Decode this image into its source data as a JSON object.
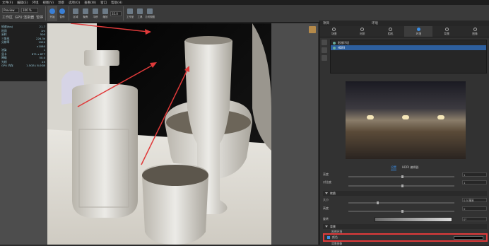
{
  "menu": [
    "文件(F)",
    "编辑(E)",
    "环境",
    "视图(V)",
    "场景",
    "选项(O)",
    "查看(W)",
    "窗口",
    "帮助(H)"
  ],
  "toolbar": {
    "render_mode": "Preview",
    "resolution": "100 %",
    "left_labels": [
      "工作区",
      "GPU 渲染器",
      "暂停"
    ],
    "buttons": [
      {
        "label": "开始"
      },
      {
        "label": "暂停"
      },
      {
        "label": "区域"
      },
      {
        "label": "聚焦"
      },
      {
        "label": "平移"
      },
      {
        "label": "缩放"
      }
    ],
    "fov_value": "35.0",
    "right_buttons": [
      {
        "label": "工作室"
      },
      {
        "label": "工具"
      },
      {
        "label": "几何视图"
      }
    ]
  },
  "stats": [
    [
      "帧速(fps)",
      "21.7"
    ],
    [
      "时间",
      "1m"
    ],
    [
      "采样",
      "500"
    ],
    [
      "三角形",
      "226.3k"
    ],
    [
      "分辨率",
      "1920"
    ],
    [
      "",
      "x1080"
    ],
    [
      "渲染",
      "1"
    ],
    [
      "显卡",
      "871 x 877"
    ],
    [
      "降噪",
      "50.0"
    ],
    [
      "光线",
      "25"
    ],
    [
      "GPU 内存",
      "1.5GB / 8.0GB"
    ]
  ],
  "panel": {
    "title": "项目",
    "header_right": "环境",
    "tabs": [
      {
        "label": "场景"
      },
      {
        "label": "材质"
      },
      {
        "label": "相机"
      },
      {
        "label": "环境"
      },
      {
        "label": "背景"
      },
      {
        "label": "图像"
      }
    ],
    "env_items": [
      {
        "label": "影棚环境"
      },
      {
        "label": "HDRI"
      }
    ],
    "subtabs": [
      "设置",
      "HDRI 编辑器"
    ],
    "rows": {
      "brightness": {
        "label": "亮度",
        "value": "1"
      },
      "contrast": {
        "label": "对比度",
        "value": "1"
      },
      "size": {
        "label": "大小",
        "value": "0.5 厘米"
      },
      "height": {
        "label": "高度",
        "value": "0"
      },
      "rotation": {
        "label": "旋转",
        "value": "0°"
      }
    },
    "sections": {
      "transform": "转换",
      "background": "背景",
      "ground": "地面"
    },
    "bg_option_label": "照明环境",
    "bg_color_label": "颜色",
    "bg_image_label": "背景图像",
    "ground_shadow_label": "地面阴影"
  },
  "colors": {
    "accent": "#3a8ee6",
    "highlight_box": "#e03a3a",
    "bg_color_swatch": "#050505"
  }
}
